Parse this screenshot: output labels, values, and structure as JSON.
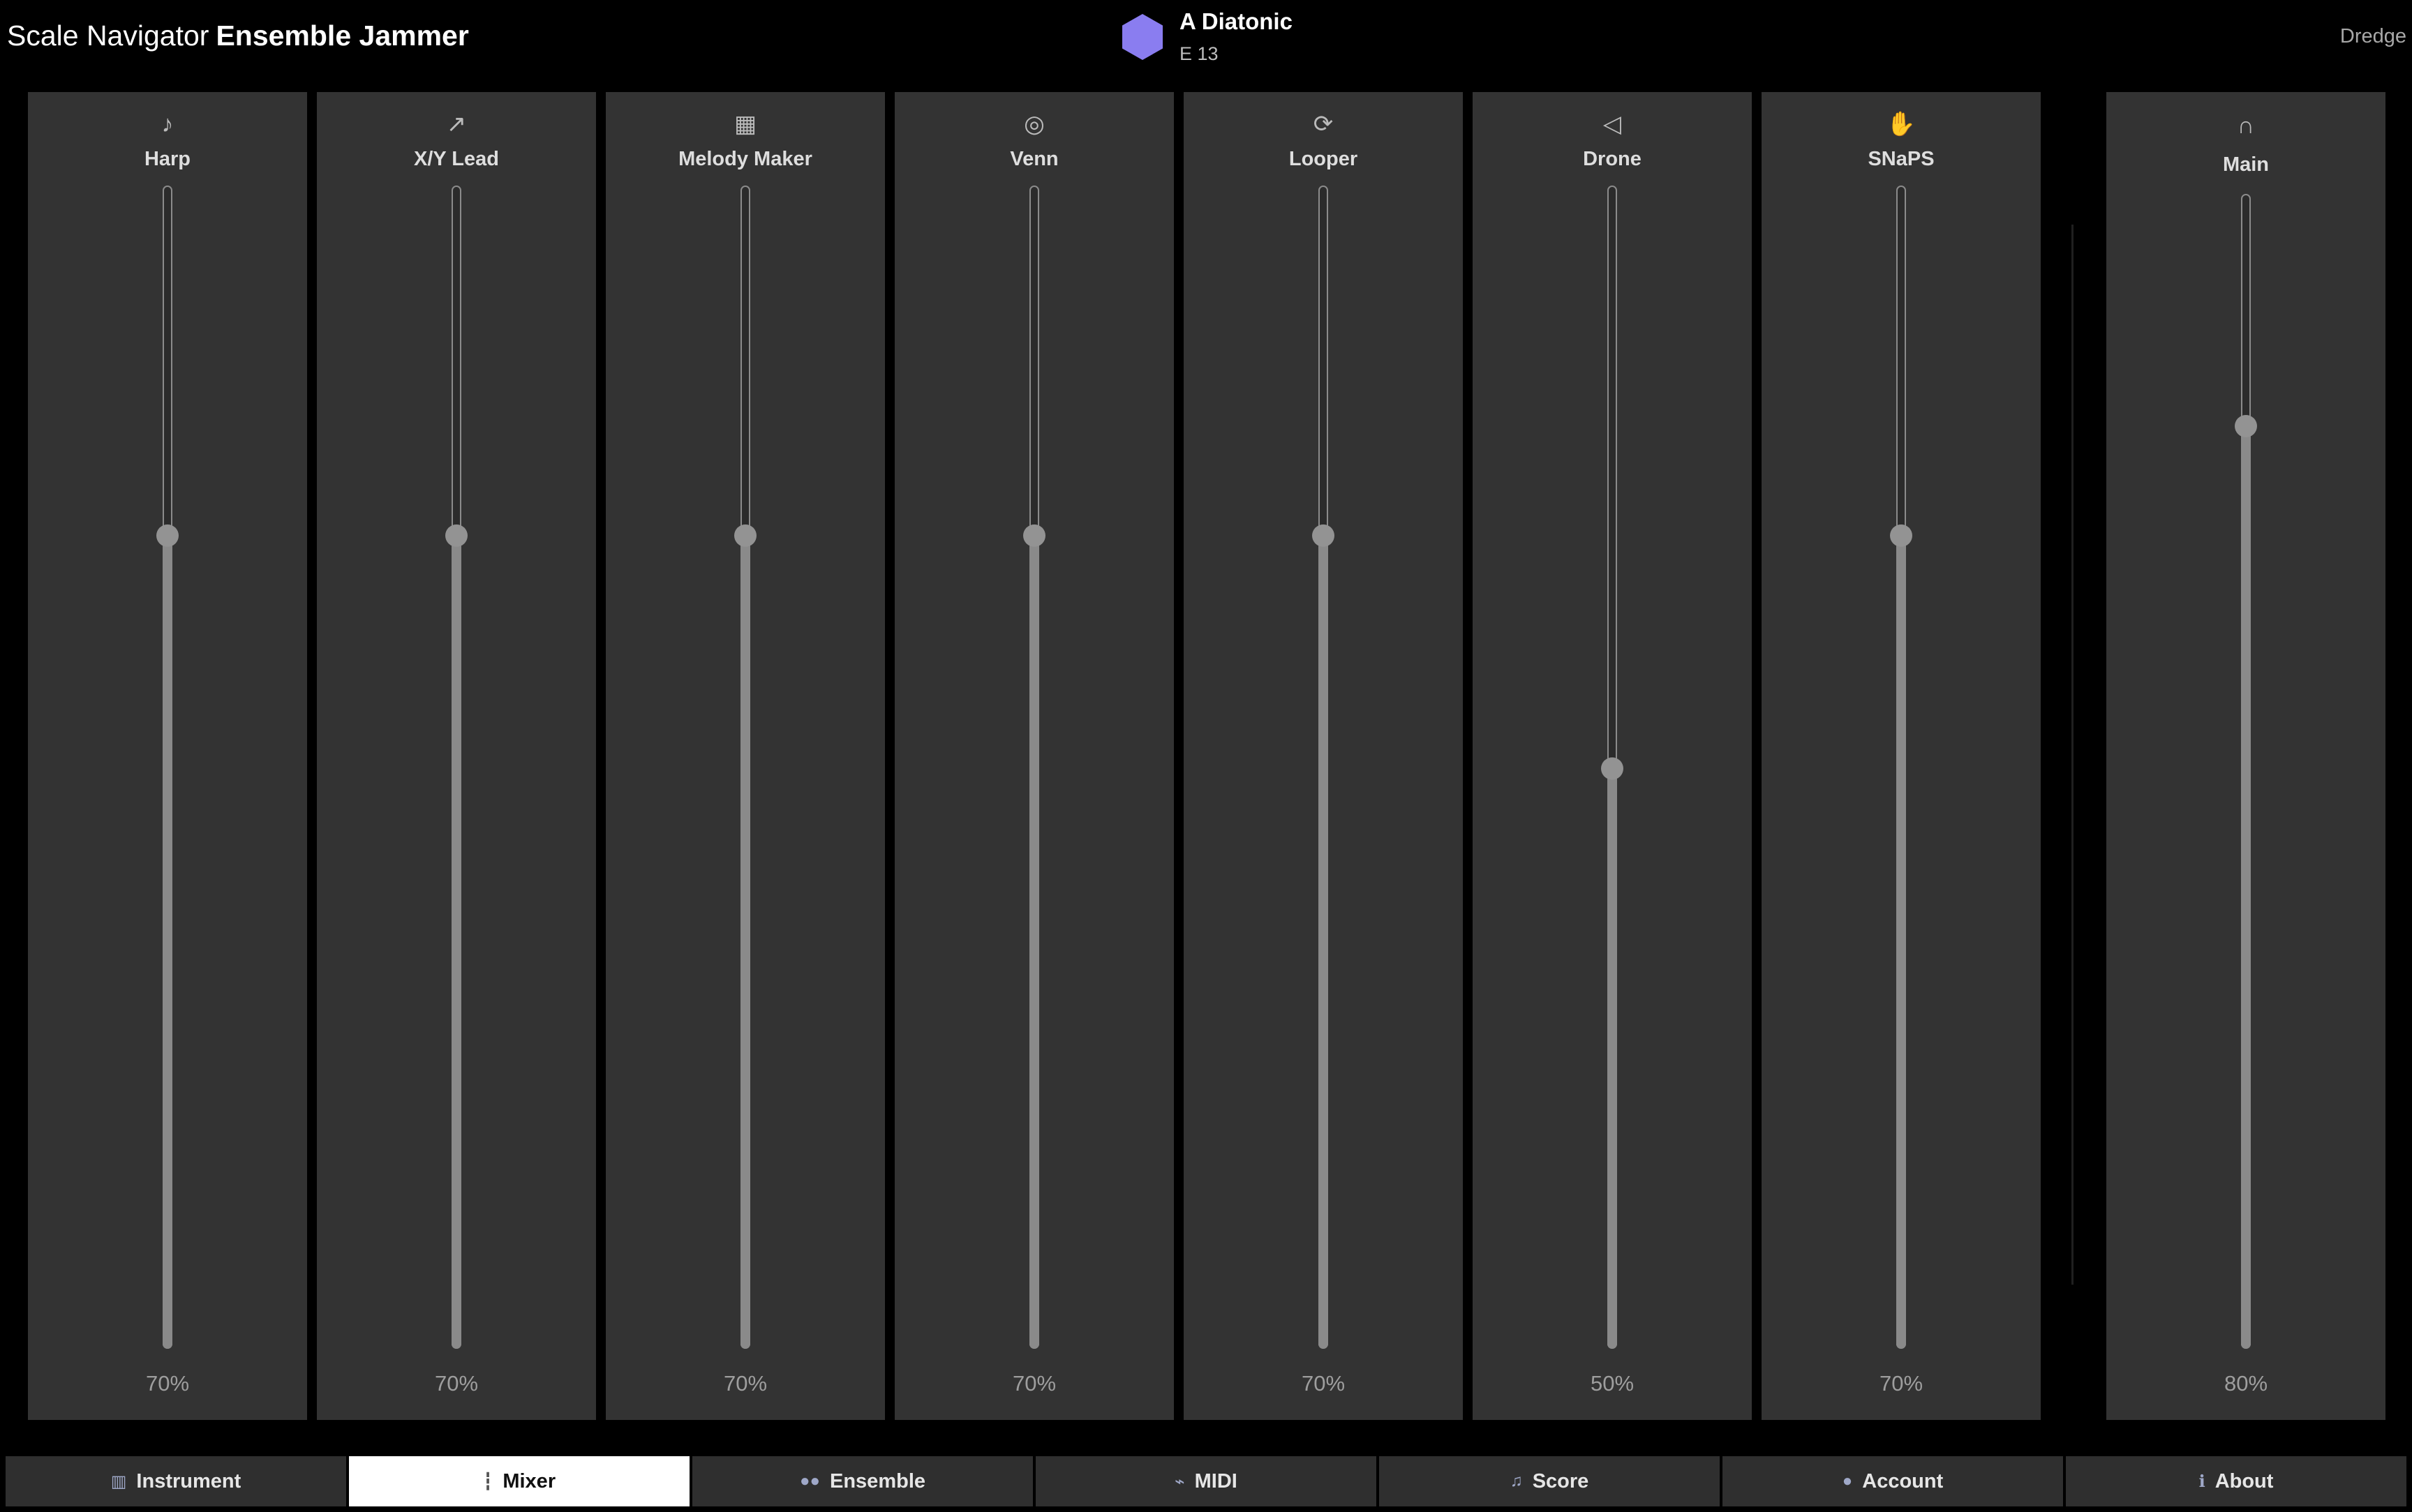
{
  "header": {
    "app_name": "Scale Navigator",
    "app_subtitle": "Ensemble Jammer",
    "scale_name": "A Diatonic",
    "chord": "E 13",
    "user": "Dredge",
    "scale_color": "#8a7df0"
  },
  "mixer": {
    "channels": [
      {
        "label": "Harp",
        "icon": "harp-icon",
        "glyph": "♪",
        "value": "70%",
        "level": 0.7
      },
      {
        "label": "X/Y Lead",
        "icon": "chart-icon",
        "glyph": "↗",
        "value": "70%",
        "level": 0.7
      },
      {
        "label": "Melody Maker",
        "icon": "grid-icon",
        "glyph": "▦",
        "value": "70%",
        "level": 0.7
      },
      {
        "label": "Venn",
        "icon": "venn-icon",
        "glyph": "◎",
        "value": "70%",
        "level": 0.7
      },
      {
        "label": "Looper",
        "icon": "loop-icon",
        "glyph": "⟳",
        "value": "70%",
        "level": 0.7
      },
      {
        "label": "Drone",
        "icon": "speaker-icon",
        "glyph": "◁",
        "value": "50%",
        "level": 0.5
      },
      {
        "label": "SNaPS",
        "icon": "hand-icon",
        "glyph": "✋",
        "value": "70%",
        "level": 0.7
      }
    ],
    "main": {
      "label": "Main",
      "icon": "headphones-icon",
      "glyph": "∩",
      "value": "80%",
      "level": 0.8
    }
  },
  "tabs": [
    {
      "label": "Instrument",
      "icon": "piano-icon",
      "glyph": "▥",
      "selected": false
    },
    {
      "label": "Mixer",
      "icon": "mixer-icon",
      "glyph": "┇",
      "selected": true
    },
    {
      "label": "Ensemble",
      "icon": "people-icon",
      "glyph": "●●",
      "selected": false
    },
    {
      "label": "MIDI",
      "icon": "plug-icon",
      "glyph": "⌁",
      "selected": false
    },
    {
      "label": "Score",
      "icon": "score-icon",
      "glyph": "♫",
      "selected": false
    },
    {
      "label": "Account",
      "icon": "person-icon",
      "glyph": "●",
      "selected": false
    },
    {
      "label": "About",
      "icon": "info-icon",
      "glyph": "ℹ",
      "selected": false
    }
  ]
}
